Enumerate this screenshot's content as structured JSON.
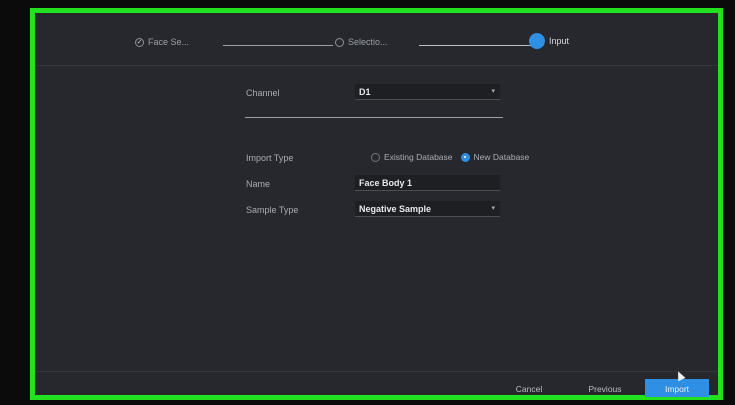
{
  "stepper": {
    "steps": [
      {
        "label": "Face Se...",
        "state": "completed"
      },
      {
        "label": "Selectio...",
        "state": "pending"
      },
      {
        "label": "Input",
        "state": "active"
      }
    ],
    "completed_mark": "✓"
  },
  "form": {
    "channel": {
      "label": "Channel",
      "value": "D1"
    },
    "import_type": {
      "label": "Import Type",
      "options": [
        {
          "label": "Existing Database",
          "selected": false
        },
        {
          "label": "New Database",
          "selected": true
        }
      ]
    },
    "name": {
      "label": "Name",
      "value": "Face Body 1"
    },
    "sample_type": {
      "label": "Sample Type",
      "value": "Negative Sample"
    }
  },
  "buttons": {
    "cancel": "Cancel",
    "previous": "Previous",
    "next": "Import"
  },
  "colors": {
    "accent": "#2f8fe3",
    "highlight_border": "#22e11e",
    "panel_bg": "#26282d"
  }
}
